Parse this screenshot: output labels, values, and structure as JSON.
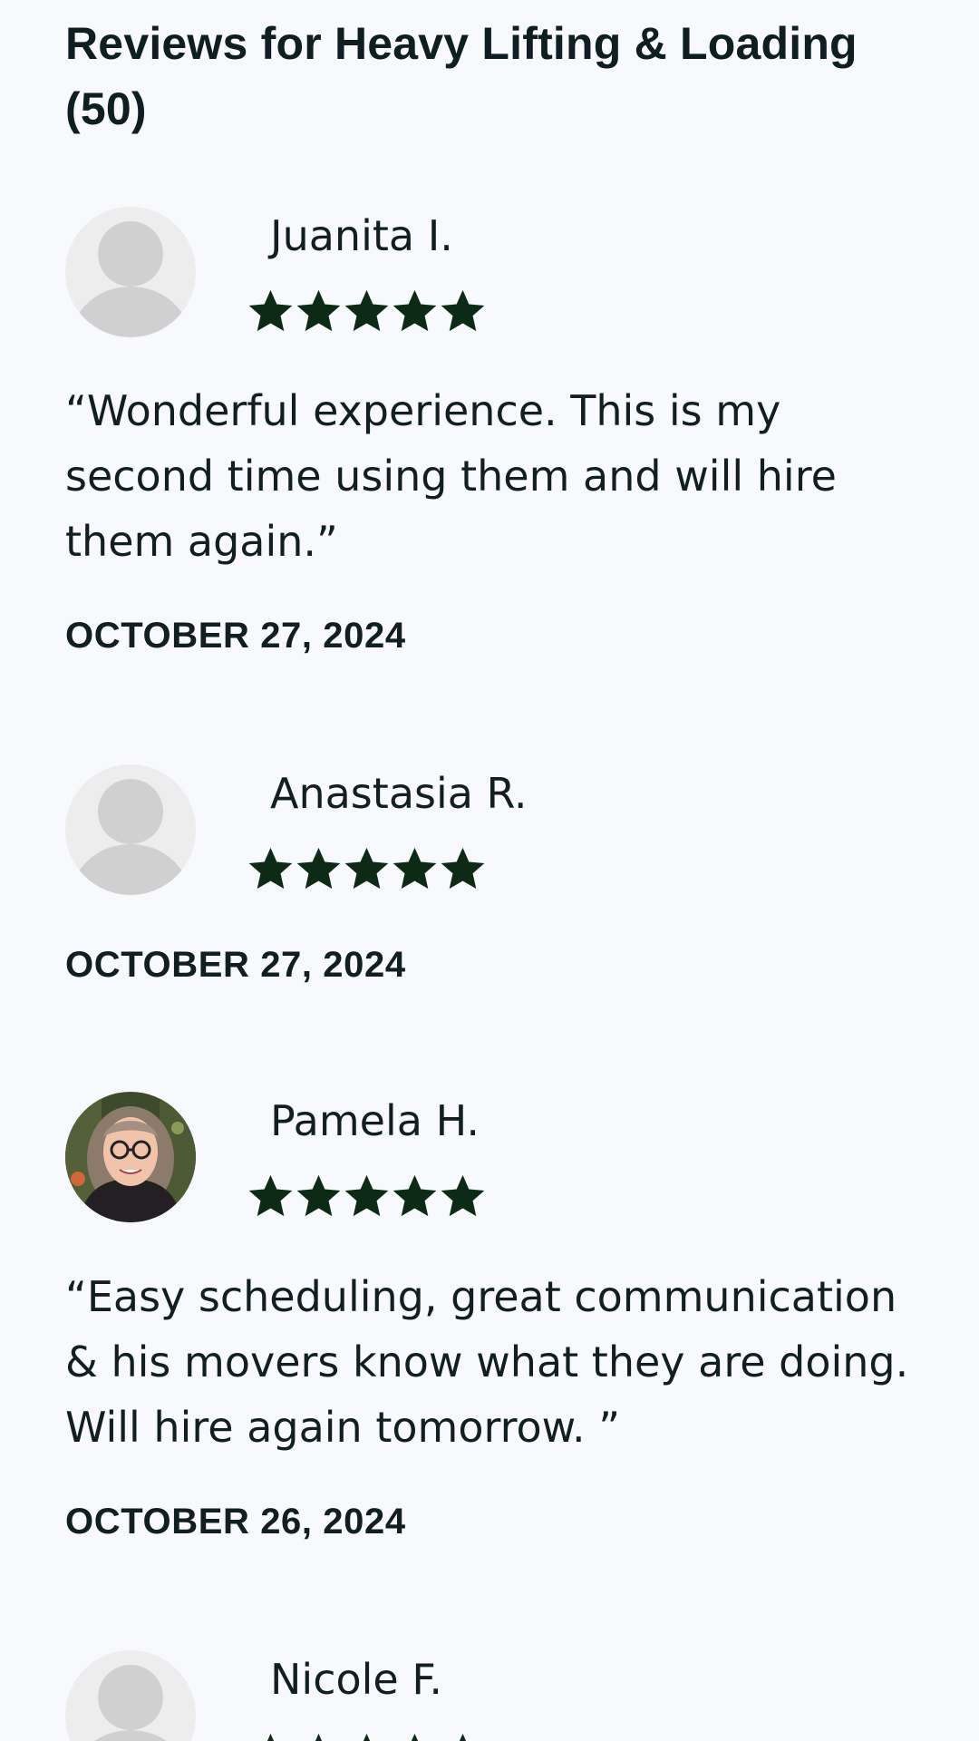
{
  "heading": "Reviews for Heavy Lifting & Loading (50)",
  "star_color": "#0d2a16",
  "reviews": [
    {
      "name": "Juanita I.",
      "rating": 5,
      "quote": "“Wonderful experience. This is my second time using them and will hire them again.”",
      "date": "OCTOBER 27, 2024",
      "avatar": "default-avatar-icon"
    },
    {
      "name": "Anastasia R.",
      "rating": 5,
      "quote": "",
      "date": "OCTOBER 27, 2024",
      "avatar": "default-avatar-icon"
    },
    {
      "name": "Pamela H.",
      "rating": 5,
      "quote": "“Easy scheduling, great communication & his movers know what they are doing. Will hire again tomorrow. ”",
      "date": "OCTOBER 26, 2024",
      "avatar": "user-photo"
    },
    {
      "name": "Nicole F.",
      "rating": 5,
      "quote": "",
      "date": "",
      "avatar": "default-avatar-icon"
    }
  ]
}
